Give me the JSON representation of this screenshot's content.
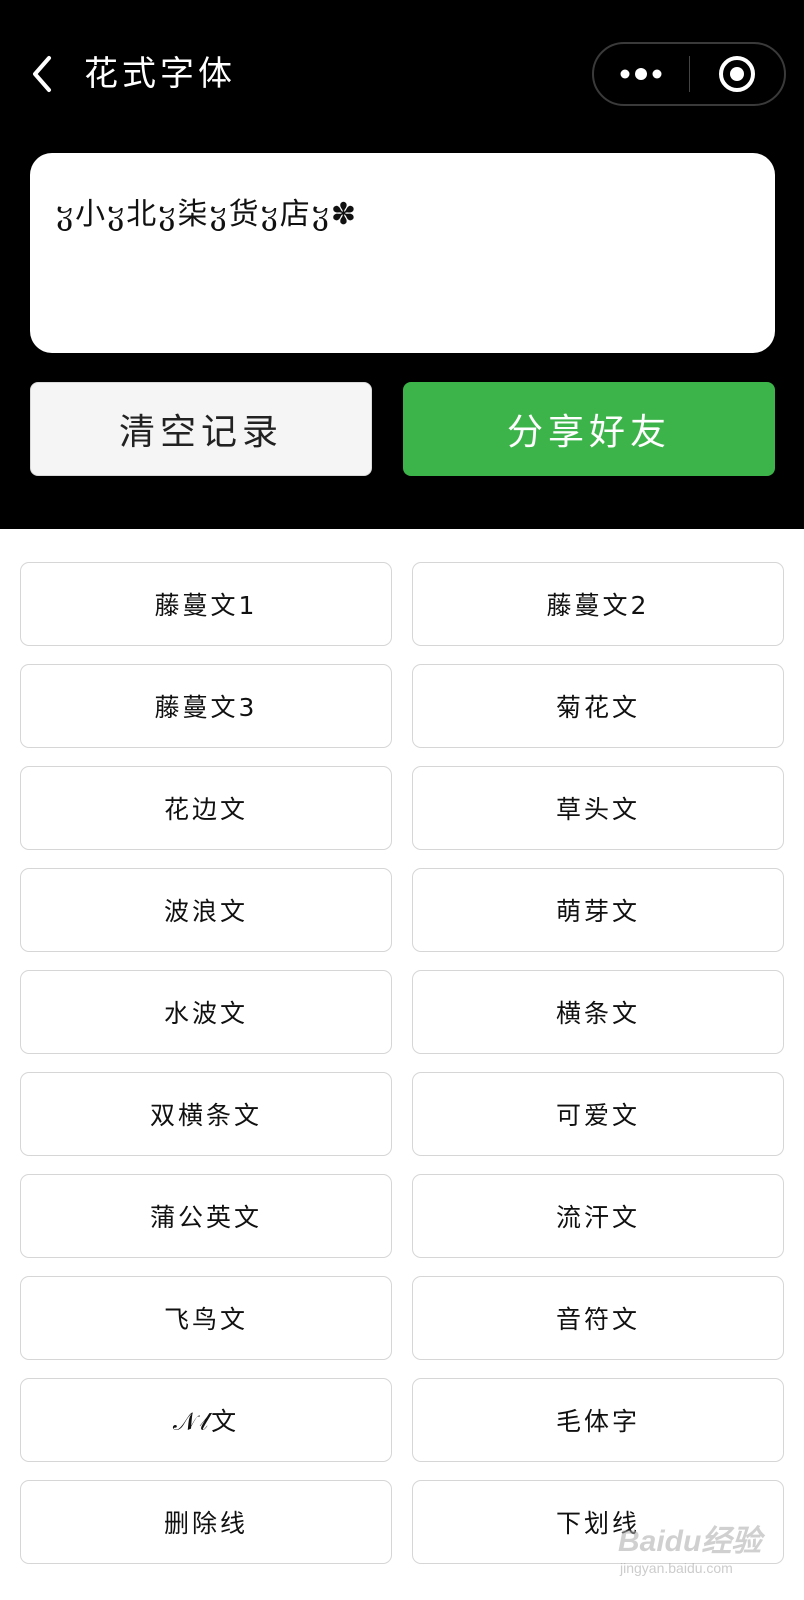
{
  "header": {
    "title": "花式字体",
    "back_icon": "chevron-left-icon",
    "more_icon": "more-dots-icon",
    "close_icon": "target-circle-icon"
  },
  "preview": {
    "text": "ჳ小ჳ北ჳ柒ჳ货ჳ店ჳ✽"
  },
  "actions": {
    "clear_label": "清空记录",
    "share_label": "分享好友",
    "share_color": "#3cb44a"
  },
  "styles": [
    {
      "label": "藤蔓文1"
    },
    {
      "label": "藤蔓文2"
    },
    {
      "label": "藤蔓文3"
    },
    {
      "label": "菊花文"
    },
    {
      "label": "花边文"
    },
    {
      "label": "草头文"
    },
    {
      "label": "波浪文"
    },
    {
      "label": "萌芽文"
    },
    {
      "label": "水波文"
    },
    {
      "label": "横条文"
    },
    {
      "label": "双横条文"
    },
    {
      "label": "可爱文"
    },
    {
      "label": "蒲公英文"
    },
    {
      "label": "流汗文"
    },
    {
      "label": "飞鸟文"
    },
    {
      "label": "音符文"
    },
    {
      "label": "𝒩𝓁文"
    },
    {
      "label": "毛体字"
    },
    {
      "label": "删除线"
    },
    {
      "label": "下划线"
    }
  ],
  "watermark": {
    "brand": "Baidu经验",
    "url": "jingyan.baidu.com"
  }
}
